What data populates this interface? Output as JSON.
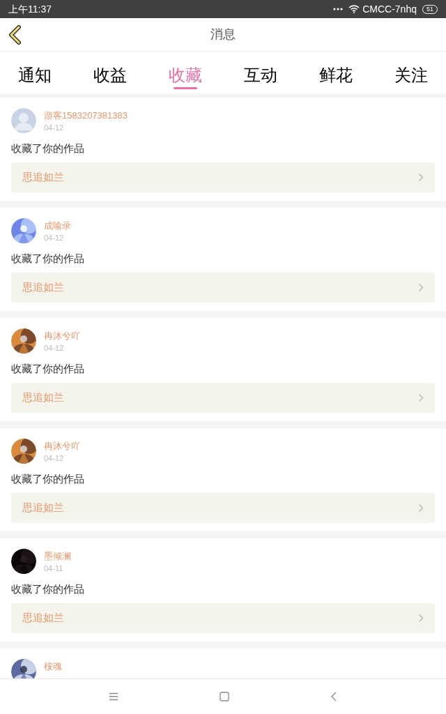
{
  "status_bar": {
    "time": "上午11:37",
    "network": "CMCC-7nhq",
    "battery": "51"
  },
  "header": {
    "title": "消息"
  },
  "tabs": [
    {
      "label": "通知",
      "selected": false
    },
    {
      "label": "收益",
      "selected": false
    },
    {
      "label": "收藏",
      "selected": true
    },
    {
      "label": "互动",
      "selected": false
    },
    {
      "label": "鲜花",
      "selected": false
    },
    {
      "label": "关注",
      "selected": false
    }
  ],
  "messages": [
    {
      "avatar": {
        "kind": "default"
      },
      "name": "游客1583207381383",
      "date": "04-12",
      "text": "收藏了你的作品",
      "work": "思追如兰"
    },
    {
      "name": "成喻录",
      "date": "04-12",
      "text": "收藏了你的作品",
      "work": "思追如兰"
    },
    {
      "name": "冉沐兮吖",
      "date": "04-12",
      "text": "收藏了你的作品",
      "work": "思追如兰"
    },
    {
      "name": "冉沐兮吖",
      "date": "04-12",
      "text": "收藏了你的作品",
      "work": "思追如兰"
    },
    {
      "name": "墨倾澜",
      "date": "04-11",
      "text": "收藏了你的作品",
      "work": "思追如兰"
    },
    {
      "name": "桉魂"
    }
  ]
}
